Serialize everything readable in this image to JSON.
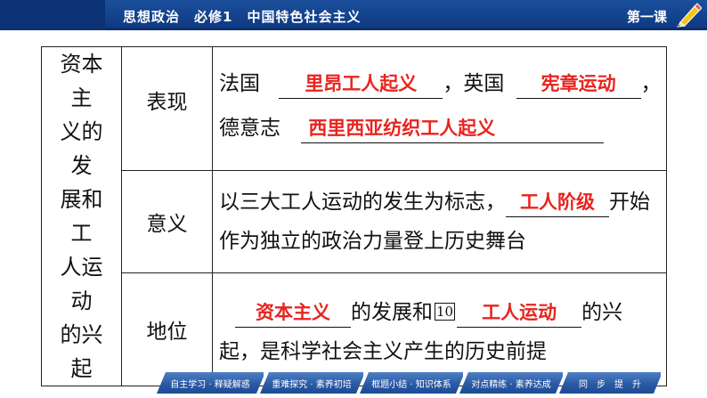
{
  "header": {
    "subject": "思想政治　必修1　中国特色社会主义",
    "lesson": "第一课",
    "icon": "pencil-icon"
  },
  "table": {
    "main_label": [
      "资本主",
      "义的发",
      "展和工",
      "人运动",
      "的兴起"
    ],
    "rows": [
      {
        "label": "表现",
        "line1": {
          "pre": "法国",
          "answer1": "里昂工人起义",
          "mid": "，英国",
          "answer2": "宪章运动",
          "post": "，"
        },
        "line2": {
          "pre": "德意志",
          "answer": "西里西亚纺织工人起义"
        }
      },
      {
        "label": "意义",
        "line1": {
          "pre": "以三大工人运动的发生为标志，",
          "answer": "工人阶级",
          "post": "开始"
        },
        "line2": "作为独立的政治力量登上历史舞台"
      },
      {
        "label": "地位",
        "line1": {
          "answer1": "资本主义",
          "mid": "的发展和",
          "number": "10",
          "answer2": "工人运动",
          "post": "的兴"
        },
        "line2": "起，是科学社会主义产生的历史前提"
      }
    ]
  },
  "footer_nav": [
    "自主学习 · 释疑解惑",
    "重难探究 · 素养初培",
    "框题小结 · 知识体系",
    "对点精练 · 素养达成",
    "同　步　提　升"
  ],
  "colors": {
    "header_blue": "#1b4f9c",
    "answer_red": "#e8241f",
    "nav_blue": "#2a5aa5"
  }
}
